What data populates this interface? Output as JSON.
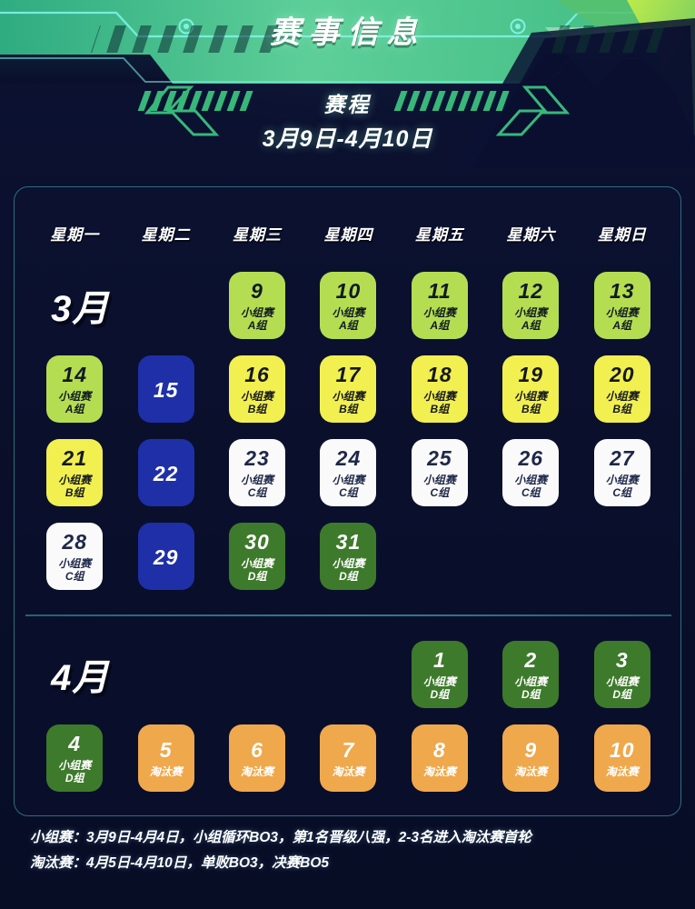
{
  "header": {
    "banner_title": "赛事信息",
    "sub_title": "赛程",
    "sub_date": "3月9日-4月10日"
  },
  "calendar": {
    "weekdays": [
      "星期一",
      "星期二",
      "星期三",
      "星期四",
      "星期五",
      "星期六",
      "星期日"
    ],
    "months": [
      {
        "label": "3月",
        "rows": [
          [
            {
              "type": "month-label",
              "text": "3月"
            },
            {
              "type": "empty"
            },
            {
              "type": "day",
              "num": "9",
              "l1": "小组赛",
              "l2": "A组",
              "variant": "lime"
            },
            {
              "type": "day",
              "num": "10",
              "l1": "小组赛",
              "l2": "A组",
              "variant": "lime"
            },
            {
              "type": "day",
              "num": "11",
              "l1": "小组赛",
              "l2": "A组",
              "variant": "lime"
            },
            {
              "type": "day",
              "num": "12",
              "l1": "小组赛",
              "l2": "A组",
              "variant": "lime"
            },
            {
              "type": "day",
              "num": "13",
              "l1": "小组赛",
              "l2": "A组",
              "variant": "lime"
            }
          ],
          [
            {
              "type": "day",
              "num": "14",
              "l1": "小组赛",
              "l2": "A组",
              "variant": "lime"
            },
            {
              "type": "day",
              "num": "15",
              "l1": "",
              "l2": "",
              "variant": "blue"
            },
            {
              "type": "day",
              "num": "16",
              "l1": "小组赛",
              "l2": "B组",
              "variant": "yellow"
            },
            {
              "type": "day",
              "num": "17",
              "l1": "小组赛",
              "l2": "B组",
              "variant": "yellow"
            },
            {
              "type": "day",
              "num": "18",
              "l1": "小组赛",
              "l2": "B组",
              "variant": "yellow"
            },
            {
              "type": "day",
              "num": "19",
              "l1": "小组赛",
              "l2": "B组",
              "variant": "yellow"
            },
            {
              "type": "day",
              "num": "20",
              "l1": "小组赛",
              "l2": "B组",
              "variant": "yellow"
            }
          ],
          [
            {
              "type": "day",
              "num": "21",
              "l1": "小组赛",
              "l2": "B组",
              "variant": "yellow"
            },
            {
              "type": "day",
              "num": "22",
              "l1": "",
              "l2": "",
              "variant": "blue"
            },
            {
              "type": "day",
              "num": "23",
              "l1": "小组赛",
              "l2": "C组",
              "variant": "white"
            },
            {
              "type": "day",
              "num": "24",
              "l1": "小组赛",
              "l2": "C组",
              "variant": "white"
            },
            {
              "type": "day",
              "num": "25",
              "l1": "小组赛",
              "l2": "C组",
              "variant": "white"
            },
            {
              "type": "day",
              "num": "26",
              "l1": "小组赛",
              "l2": "C组",
              "variant": "white"
            },
            {
              "type": "day",
              "num": "27",
              "l1": "小组赛",
              "l2": "C组",
              "variant": "white"
            }
          ],
          [
            {
              "type": "day",
              "num": "28",
              "l1": "小组赛",
              "l2": "C组",
              "variant": "white"
            },
            {
              "type": "day",
              "num": "29",
              "l1": "",
              "l2": "",
              "variant": "blue"
            },
            {
              "type": "day",
              "num": "30",
              "l1": "小组赛",
              "l2": "D组",
              "variant": "dgreen"
            },
            {
              "type": "day",
              "num": "31",
              "l1": "小组赛",
              "l2": "D组",
              "variant": "dgreen"
            },
            {
              "type": "empty"
            },
            {
              "type": "empty"
            },
            {
              "type": "empty"
            }
          ]
        ]
      },
      {
        "label": "4月",
        "rows": [
          [
            {
              "type": "month-label",
              "text": "4月"
            },
            {
              "type": "empty"
            },
            {
              "type": "empty"
            },
            {
              "type": "empty"
            },
            {
              "type": "day",
              "num": "1",
              "l1": "小组赛",
              "l2": "D组",
              "variant": "dgreen"
            },
            {
              "type": "day",
              "num": "2",
              "l1": "小组赛",
              "l2": "D组",
              "variant": "dgreen"
            },
            {
              "type": "day",
              "num": "3",
              "l1": "小组赛",
              "l2": "D组",
              "variant": "dgreen"
            }
          ],
          [
            {
              "type": "day",
              "num": "4",
              "l1": "小组赛",
              "l2": "D组",
              "variant": "dgreen"
            },
            {
              "type": "day",
              "num": "5",
              "l1": "淘汰赛",
              "l2": "",
              "variant": "orange"
            },
            {
              "type": "day",
              "num": "6",
              "l1": "淘汰赛",
              "l2": "",
              "variant": "orange"
            },
            {
              "type": "day",
              "num": "7",
              "l1": "淘汰赛",
              "l2": "",
              "variant": "orange"
            },
            {
              "type": "day",
              "num": "8",
              "l1": "淘汰赛",
              "l2": "",
              "variant": "orange"
            },
            {
              "type": "day",
              "num": "9",
              "l1": "淘汰赛",
              "l2": "",
              "variant": "orange"
            },
            {
              "type": "day",
              "num": "10",
              "l1": "淘汰赛",
              "l2": "",
              "variant": "orange"
            }
          ]
        ]
      }
    ]
  },
  "footer": {
    "lines": [
      "小组赛：3月9日-4月4日，小组循环BO3，第1名晋级八强，2-3名进入淘汰赛首轮",
      "淘汰赛：4月5日-4月10日，单败BO3，决赛BO5"
    ]
  },
  "colors": {
    "background": "#0a0f2e",
    "banner_green": "#5fc98f",
    "accent_cyan": "#6ff0e0",
    "panel_border": "#2d6e80",
    "group_a": "#b4dd52",
    "group_b": "#f2ef50",
    "group_c": "#fafafa",
    "group_d": "#3e7a2b",
    "knockout": "#efa84c",
    "rest_day": "#1f2fa8"
  }
}
